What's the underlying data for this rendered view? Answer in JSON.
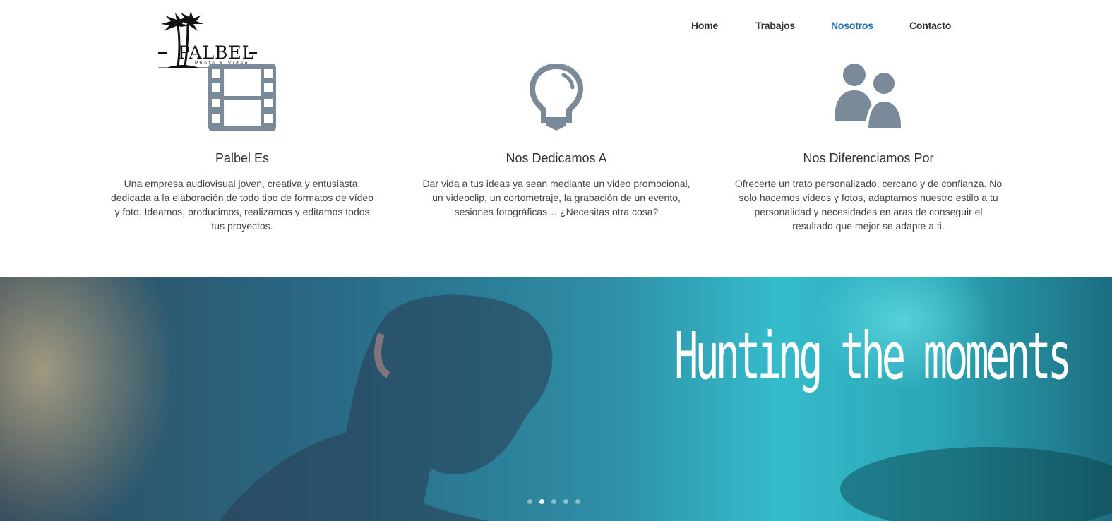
{
  "logo": {
    "name": "PALBEL",
    "tagline": "Photo & Video"
  },
  "nav": {
    "items": [
      {
        "label": "Home",
        "active": false
      },
      {
        "label": "Trabajos",
        "active": false
      },
      {
        "label": "Nosotros",
        "active": true
      },
      {
        "label": "Contacto",
        "active": false
      }
    ],
    "active_color": "#1f6fb5"
  },
  "features": [
    {
      "icon": "film-strip-icon",
      "title": "Palbel Es",
      "text": "Una empresa audiovisual joven, creativa y entusiasta, dedicada a la elaboración de todo tipo de formatos de vídeo y foto. Ideamos, producimos, realizamos y editamos todos tus proyectos."
    },
    {
      "icon": "lightbulb-icon",
      "title": "Nos Dedicamos A",
      "text": "Dar vida a tus ideas ya sean mediante un video promocional, un videoclip, un cortometraje, la grabación de un evento, sesiones fotográficas… ¿Necesitas otra cosa?"
    },
    {
      "icon": "users-icon",
      "title": "Nos Diferenciamos Por",
      "text": "Ofrecerte un trato personalizado, cercano y de confianza. No solo hacemos videos y fotos, adaptamos nuestro estilo a tu personalidad y necesidades en aras de conseguir el resultado que mejor se adapte a ti."
    }
  ],
  "icon_color": "#7b8a99",
  "hero": {
    "tagline": "Hunting the moments",
    "slides_total": 5,
    "active_slide": 2
  }
}
